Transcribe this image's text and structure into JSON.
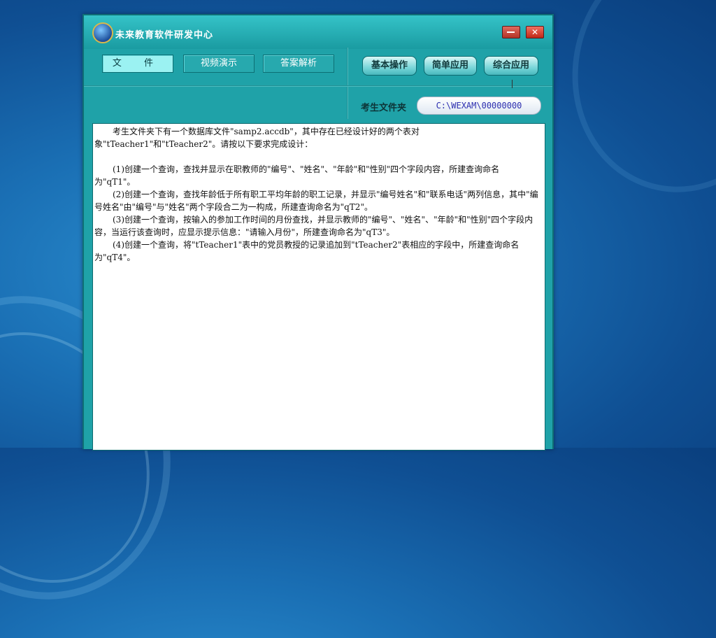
{
  "window": {
    "title": "未来教育软件研发中心",
    "close_glyph": "✕"
  },
  "tabs": [
    {
      "label": "文 件",
      "active": true
    },
    {
      "label": "视频演示",
      "active": false
    },
    {
      "label": "答案解析",
      "active": false
    }
  ],
  "actions": [
    {
      "label": "基本操作"
    },
    {
      "label": "简单应用"
    },
    {
      "label": "综合应用"
    }
  ],
  "folder": {
    "label": "考生文件夹",
    "path": "C:\\WEXAM\\00000000"
  },
  "content": {
    "intro": "考生文件夹下有一个数据库文件\"samp2.accdb\"，其中存在已经设计好的两个表对象\"tTeacher1\"和\"tTeacher2\"。请按以下要求完成设计：",
    "items": [
      "(1)创建一个查询，查找并显示在职教师的\"编号\"、\"姓名\"、\"年龄\"和\"性别\"四个字段内容，所建查询命名为\"qT1\"。",
      "(2)创建一个查询，查找年龄低于所有职工平均年龄的职工记录，并显示\"编号姓名\"和\"联系电话\"两列信息，其中\"编号姓名\"由\"编号\"与\"姓名\"两个字段合二为一构成，所建查询命名为\"qT2\"。",
      "(3)创建一个查询，按输入的参加工作时间的月份查找，并显示教师的\"编号\"、\"姓名\"、\"年龄\"和\"性别\"四个字段内容，当运行该查询时，应显示提示信息：\"请输入月份\"，所建查询命名为\"qT3\"。",
      "(4)创建一个查询，将\"tTeacher1\"表中的党员教授的记录追加到\"tTeacher2\"表相应的字段中，所建查询命名为\"qT4\"。"
    ]
  },
  "colors": {
    "window_bg": "#1fa2a8",
    "active_tab": "#9bf2f2",
    "path_text": "#2d2fb0"
  }
}
